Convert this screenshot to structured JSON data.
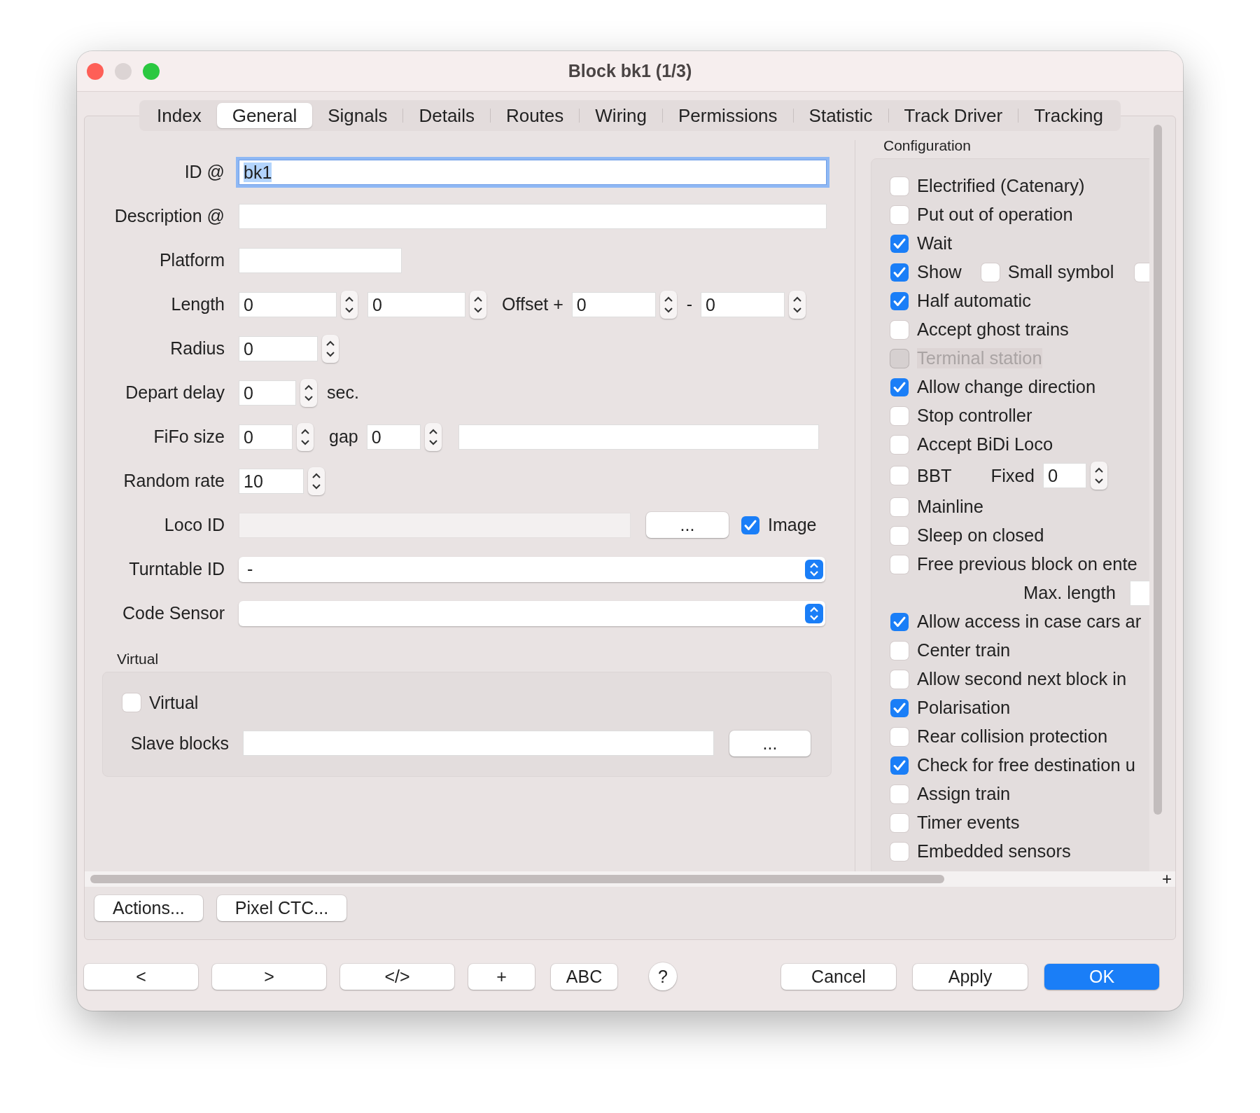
{
  "window": {
    "title": "Block bk1 (1/3)"
  },
  "tabs": [
    {
      "label": "Index",
      "selected": false
    },
    {
      "label": "General",
      "selected": true
    },
    {
      "label": "Signals",
      "selected": false
    },
    {
      "label": "Details",
      "selected": false
    },
    {
      "label": "Routes",
      "selected": false
    },
    {
      "label": "Wiring",
      "selected": false
    },
    {
      "label": "Permissions",
      "selected": false
    },
    {
      "label": "Statistic",
      "selected": false
    },
    {
      "label": "Track Driver",
      "selected": false
    },
    {
      "label": "Tracking",
      "selected": false
    }
  ],
  "general": {
    "id": {
      "label": "ID @",
      "value": "bk1",
      "focused": true
    },
    "description": {
      "label": "Description @"
    },
    "platform": {
      "label": "Platform"
    },
    "length": {
      "label": "Length",
      "value_1": "0",
      "value_2": "0",
      "offset_label": "Offset +",
      "offset_1": "0",
      "separator": "-",
      "offset_2": "0"
    },
    "radius": {
      "label": "Radius",
      "value": "0"
    },
    "depart_delay": {
      "label": "Depart delay",
      "value": "0",
      "unit": "sec."
    },
    "fifo": {
      "label": "FiFo size",
      "value": "0",
      "gap_label": "gap",
      "gap": "0"
    },
    "random_rate": {
      "label": "Random rate",
      "value": "10"
    },
    "loco_id": {
      "label": "Loco ID",
      "button": "...",
      "image_label": "Image",
      "image_checked": true
    },
    "turntable_id": {
      "label": "Turntable ID",
      "value": "-"
    },
    "code_sensor": {
      "label": "Code Sensor"
    },
    "virtual": {
      "title": "Virtual",
      "checkbox_label": "Virtual",
      "checked": false,
      "slave_label": "Slave blocks",
      "button": "..."
    }
  },
  "configuration": {
    "title": "Configuration",
    "items": [
      {
        "kind": "checkbox",
        "label": "Electrified (Catenary)",
        "checked": false,
        "disabled": false
      },
      {
        "kind": "checkbox",
        "label": "Put out of operation",
        "checked": false,
        "disabled": false
      },
      {
        "kind": "checkbox",
        "label": "Wait",
        "checked": true,
        "disabled": false
      },
      {
        "kind": "pair",
        "label": "Show",
        "checked": true,
        "label_2": "Small symbol",
        "checked_2": false,
        "checked_3": false
      },
      {
        "kind": "checkbox",
        "label": "Half automatic",
        "checked": true,
        "disabled": false
      },
      {
        "kind": "checkbox",
        "label": "Accept ghost trains",
        "checked": false,
        "disabled": false
      },
      {
        "kind": "checkbox",
        "label": "Terminal station",
        "checked": false,
        "disabled": true
      },
      {
        "kind": "checkbox",
        "label": "Allow change direction",
        "checked": true,
        "disabled": false
      },
      {
        "kind": "checkbox",
        "label": "Stop controller",
        "checked": false,
        "disabled": false
      },
      {
        "kind": "checkbox",
        "label": "Accept BiDi Loco",
        "checked": false,
        "disabled": false
      },
      {
        "kind": "spin",
        "label": "BBT",
        "checked": false,
        "field_label": "Fixed",
        "value": "0"
      },
      {
        "kind": "checkbox",
        "label": "Mainline",
        "checked": false,
        "disabled": false
      },
      {
        "kind": "checkbox",
        "label": "Sleep on closed",
        "checked": false,
        "disabled": false
      },
      {
        "kind": "checkbox",
        "label": "Free previous block on ente",
        "checked": false,
        "disabled": false
      },
      {
        "kind": "field",
        "label": "Max. length"
      },
      {
        "kind": "checkbox",
        "label": "Allow access in case cars ar",
        "checked": true,
        "disabled": false
      },
      {
        "kind": "checkbox",
        "label": "Center train",
        "checked": false,
        "disabled": false
      },
      {
        "kind": "checkbox",
        "label": "Allow second next block in",
        "checked": false,
        "disabled": false
      },
      {
        "kind": "checkbox",
        "label": "Polarisation",
        "checked": true,
        "disabled": false
      },
      {
        "kind": "checkbox",
        "label": "Rear collision protection",
        "checked": false,
        "disabled": false
      },
      {
        "kind": "checkbox",
        "label": "Check for free destination u",
        "checked": true,
        "disabled": false
      },
      {
        "kind": "checkbox",
        "label": "Assign train",
        "checked": false,
        "disabled": false
      },
      {
        "kind": "checkbox",
        "label": "Timer events",
        "checked": false,
        "disabled": false
      },
      {
        "kind": "checkbox",
        "label": "Embedded sensors",
        "checked": false,
        "disabled": false
      }
    ]
  },
  "scroll_corner": "+",
  "panel_buttons": [
    "Actions...",
    "Pixel CTC..."
  ],
  "nav_buttons": [
    {
      "label": "<",
      "kind": "wide"
    },
    {
      "label": ">",
      "kind": "wide"
    },
    {
      "label": "</>",
      "kind": "wide"
    },
    {
      "label": "+",
      "kind": "narrow"
    },
    {
      "label": "ABC",
      "kind": "narrow"
    },
    {
      "label": "?",
      "kind": "help"
    }
  ],
  "dialog_buttons": [
    {
      "label": "Cancel",
      "default": false
    },
    {
      "label": "Apply",
      "default": false
    },
    {
      "label": "OK",
      "default": true
    }
  ]
}
